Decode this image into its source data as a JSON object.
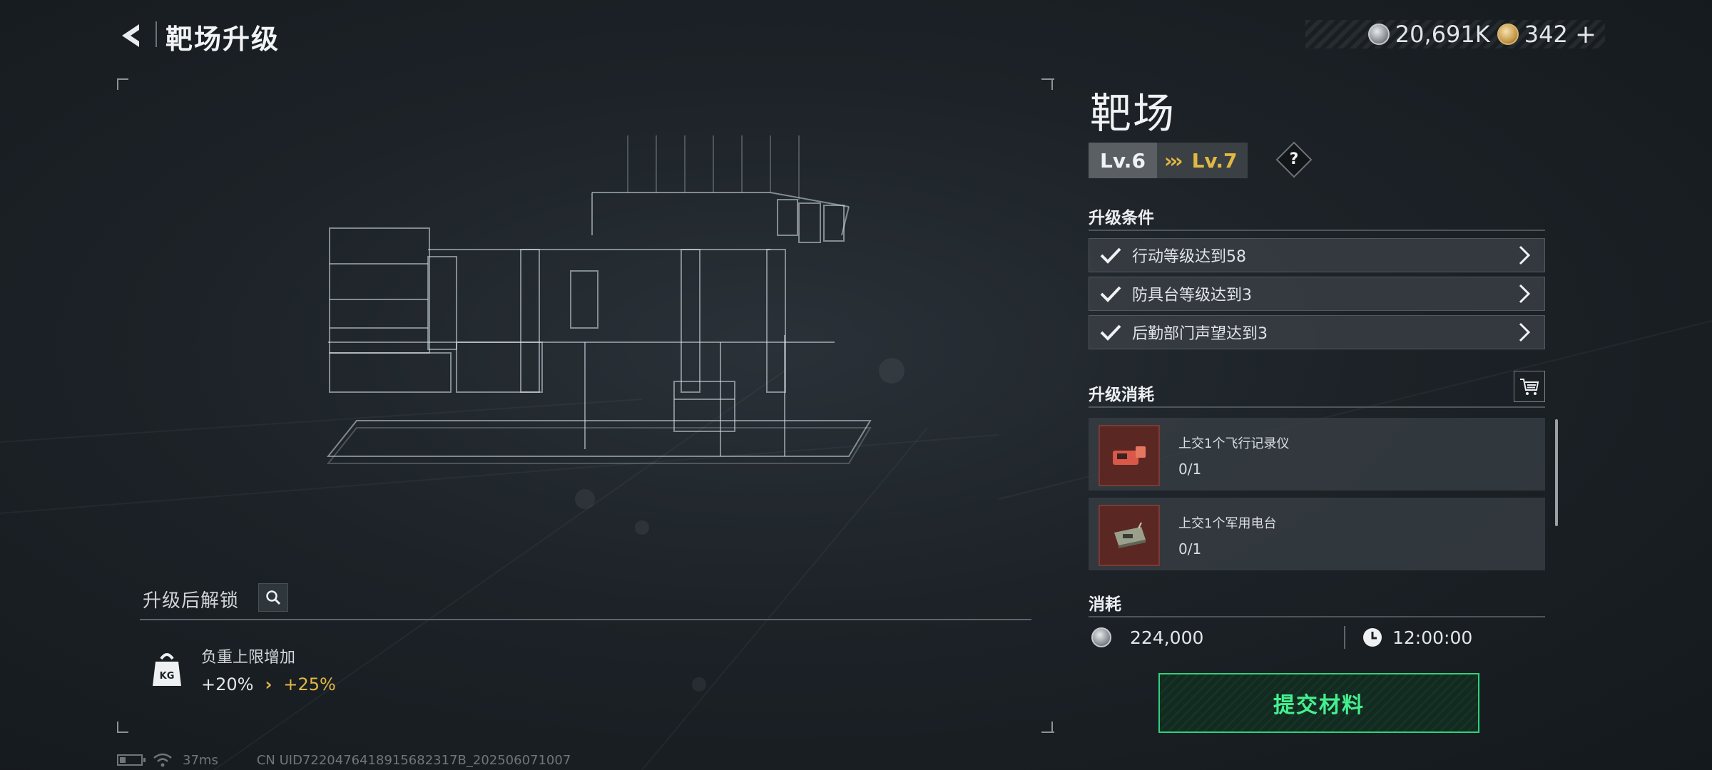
{
  "header": {
    "title": "靶场升级",
    "silver_amount": "20,691K",
    "gold_amount": "342"
  },
  "facility": {
    "name": "靶场",
    "level_current": "Lv.6",
    "level_next": "Lv.7",
    "help_label": "?"
  },
  "conditions": {
    "title": "升级条件",
    "items": [
      {
        "text": "行动等级达到58"
      },
      {
        "text": "防具台等级达到3"
      },
      {
        "text": "后勤部门声望达到3"
      }
    ]
  },
  "upgrade_cost": {
    "title": "升级消耗",
    "items": [
      {
        "name": "上交1个飞行记录仪",
        "progress": "0/1"
      },
      {
        "name": "上交1个军用电台",
        "progress": "0/1"
      }
    ]
  },
  "consume": {
    "title": "消耗",
    "silver": "224,000",
    "time": "12:00:00"
  },
  "submit_label": "提交材料",
  "unlock": {
    "title": "升级后解锁",
    "item_name": "负重上限增加",
    "old_value": "+20%",
    "new_value": "+25%",
    "icon_text": "KG"
  },
  "status_bar": {
    "ping": "37ms",
    "uid": "CN UID7220476418915682317B_202506071007"
  },
  "colors": {
    "accent_gold": "#e2b843",
    "accent_green": "#44f08f"
  }
}
